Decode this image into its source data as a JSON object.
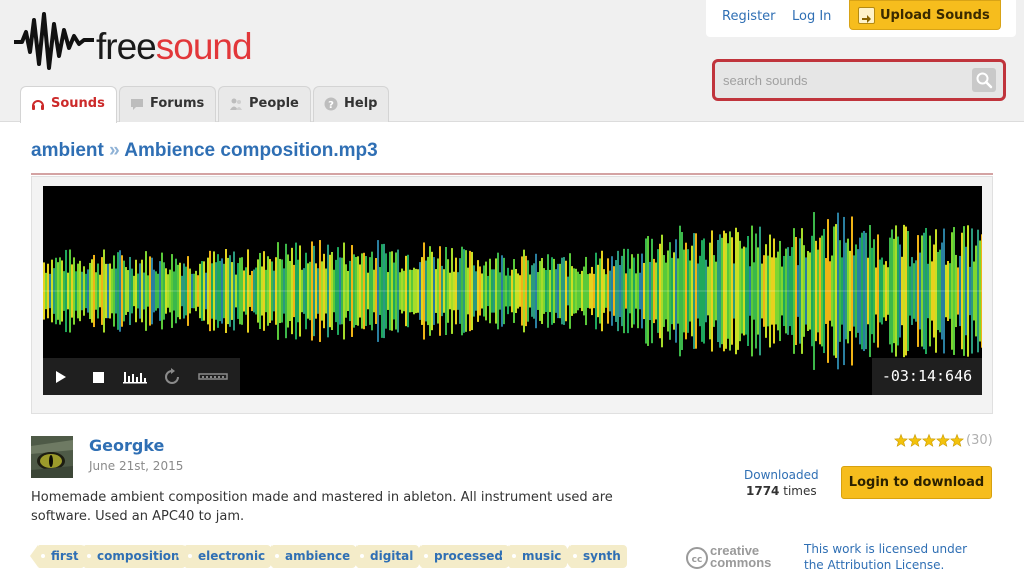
{
  "brand": {
    "name_part1": "free",
    "name_part2": "sound",
    "color": "#e2373a"
  },
  "header": {
    "register_label": "Register",
    "login_label": "Log In",
    "upload_label": "Upload Sounds",
    "search_placeholder": "search sounds",
    "tabs": [
      {
        "label": "Sounds",
        "icon": "headphones-icon",
        "active": true
      },
      {
        "label": "Forums",
        "icon": "speech-bubble-icon",
        "active": false
      },
      {
        "label": "People",
        "icon": "people-icon",
        "active": false
      },
      {
        "label": "Help",
        "icon": "help-icon",
        "active": false
      }
    ]
  },
  "breadcrumb": {
    "pack": "ambient",
    "separator": "»",
    "sound": "Ambience composition.mp3"
  },
  "player": {
    "time_display": "-03:14:646",
    "controls": [
      "play-icon",
      "stop-icon",
      "spectrogram-toggle-icon",
      "loop-icon",
      "scale-toggle-icon"
    ]
  },
  "sound": {
    "username": "Georgke",
    "date": "June 21st, 2015",
    "description": "Homemade ambient composition made and mastered in ableton. All instrument used are software. Used an APC40 to jam.",
    "rating": 5,
    "rating_count": "(30)",
    "downloaded_label": "Downloaded",
    "download_count": "1774",
    "download_suffix": "times",
    "download_button": "Login to download",
    "tags": [
      "first",
      "composition",
      "electronic",
      "ambience",
      "digital",
      "processed",
      "music",
      "synth"
    ],
    "license_logo_text_1": "creative",
    "license_logo_text_2": "commons",
    "license_line1": "This work is licensed under",
    "license_line2": "the Attribution License."
  },
  "colors": {
    "link": "#2f6fb4",
    "accent_button": "#f6bd1d",
    "search_border": "#c0343c"
  }
}
